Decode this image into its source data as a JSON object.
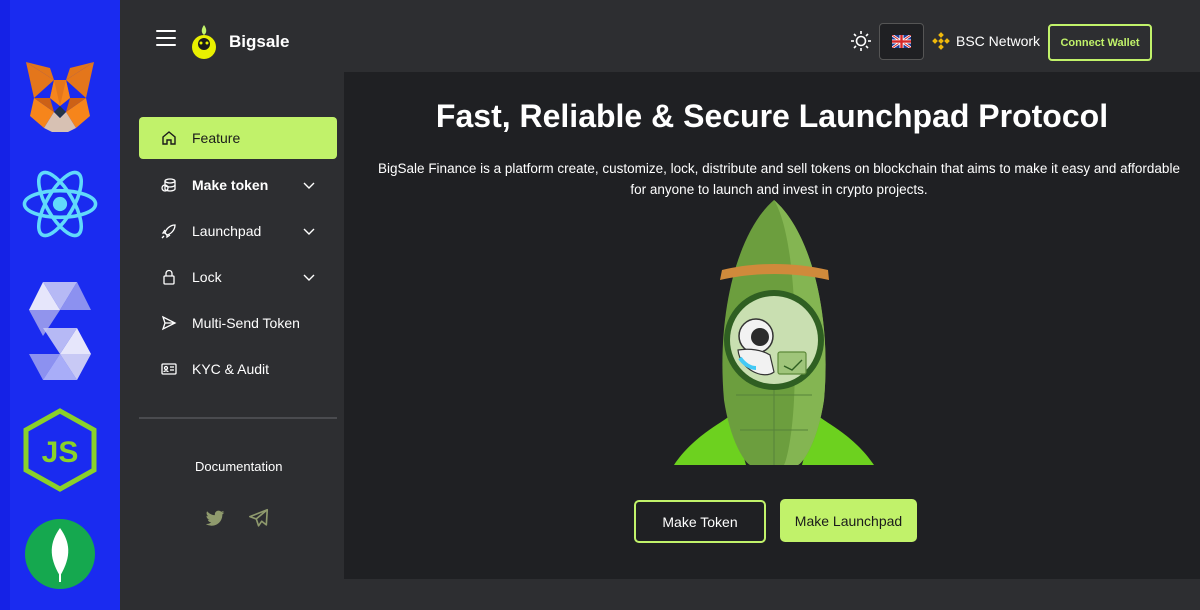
{
  "colors": {
    "accent": "#c1f26a",
    "panel": "#1f2023",
    "chrome": "#2d2e31",
    "strip": "#1a2bf0"
  },
  "tech_strip": {
    "logos": [
      "metamask-logo",
      "react-logo",
      "solidity-logo",
      "nodejs-logo",
      "mongodb-logo"
    ]
  },
  "header": {
    "brand": "Bigsale",
    "network": "BSC Network",
    "connect_label": "Connect Wallet",
    "language_flag": "uk-flag-icon"
  },
  "sidebar": {
    "items": [
      {
        "label": "Feature",
        "icon": "home-icon",
        "active": true
      },
      {
        "label": "Make token",
        "icon": "coins-icon",
        "expandable": true
      },
      {
        "label": "Launchpad",
        "icon": "rocket-icon",
        "expandable": true
      },
      {
        "label": "Lock",
        "icon": "lock-icon",
        "expandable": true
      },
      {
        "label": "Multi-Send Token",
        "icon": "send-icon"
      },
      {
        "label": "KYC & Audit",
        "icon": "id-card-icon"
      }
    ],
    "documentation": "Documentation",
    "social": [
      "twitter-icon",
      "telegram-icon"
    ]
  },
  "hero": {
    "title": "Fast, Reliable & Secure Launchpad Protocol",
    "subtitle": "BigSale Finance is a platform create, customize, lock, distribute and sell tokens on blockchain that aims to make it easy and affordable for anyone to launch and invest in crypto projects.",
    "make_token": "Make Token",
    "make_launchpad": "Make Launchpad"
  }
}
